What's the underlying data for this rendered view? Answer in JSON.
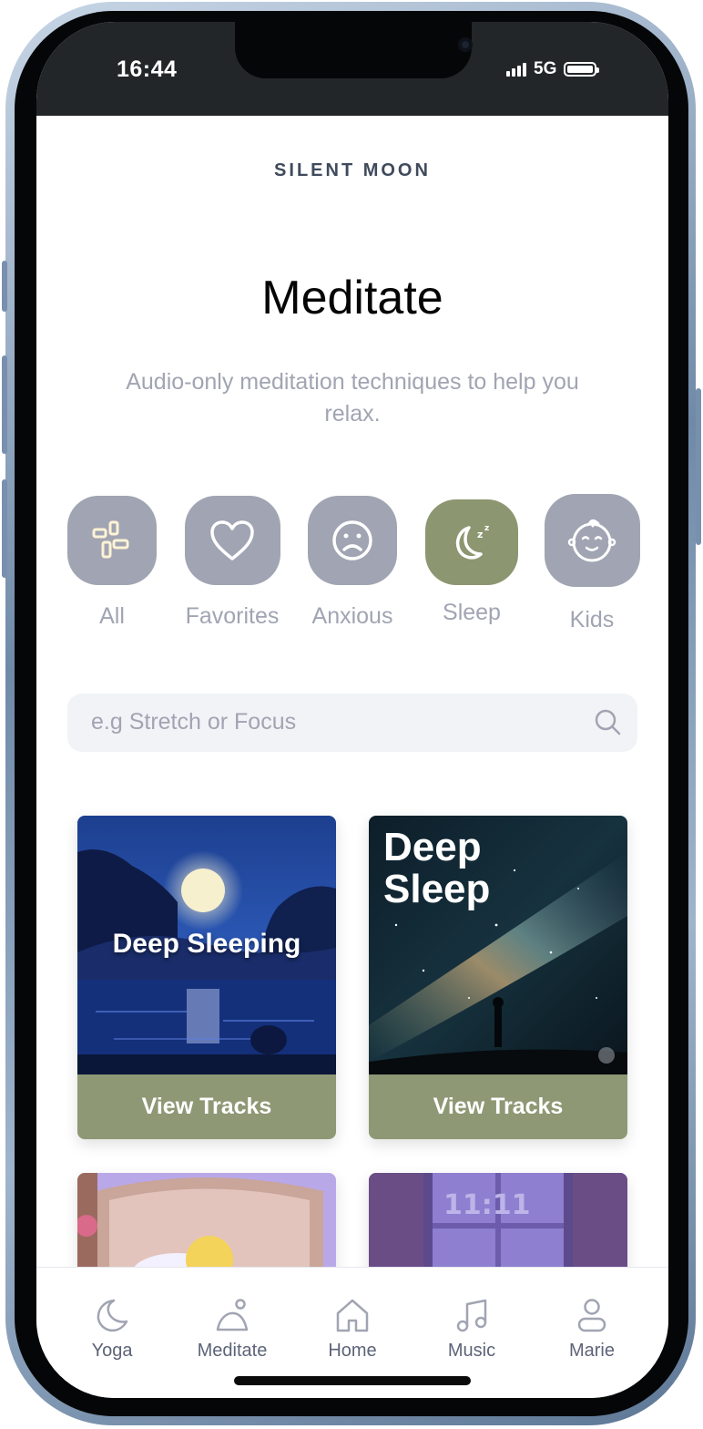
{
  "status_bar": {
    "time": "16:44",
    "network": "5G"
  },
  "brand": "SILENT MOON",
  "title": "Meditate",
  "subtitle": "Audio-only meditation techniques to help you relax.",
  "categories": [
    {
      "label": "All",
      "icon": "grid-icon",
      "active": false
    },
    {
      "label": "Favorites",
      "icon": "heart-icon",
      "active": false
    },
    {
      "label": "Anxious",
      "icon": "sad-face-icon",
      "active": false
    },
    {
      "label": "Sleep",
      "icon": "moon-zzz-icon",
      "active": true
    },
    {
      "label": "Kids",
      "icon": "baby-face-icon",
      "active": false
    }
  ],
  "search": {
    "placeholder": "e.g Stretch or Focus"
  },
  "cards": [
    {
      "art_text": "Deep Sleeping",
      "button": "View Tracks"
    },
    {
      "art_text": "Deep Sleep",
      "button": "View Tracks"
    }
  ],
  "tabs": [
    {
      "label": "Yoga",
      "icon": "moon-icon"
    },
    {
      "label": "Meditate",
      "icon": "meditate-icon"
    },
    {
      "label": "Home",
      "icon": "home-icon"
    },
    {
      "label": "Music",
      "icon": "music-note-icon"
    },
    {
      "label": "Marie",
      "icon": "user-icon"
    }
  ],
  "colors": {
    "accent": "#8e9875",
    "category_bg": "#a1a4b2",
    "category_active": "#8c9670",
    "text_muted": "#a1a4b2",
    "search_bg": "#f2f3f7"
  }
}
